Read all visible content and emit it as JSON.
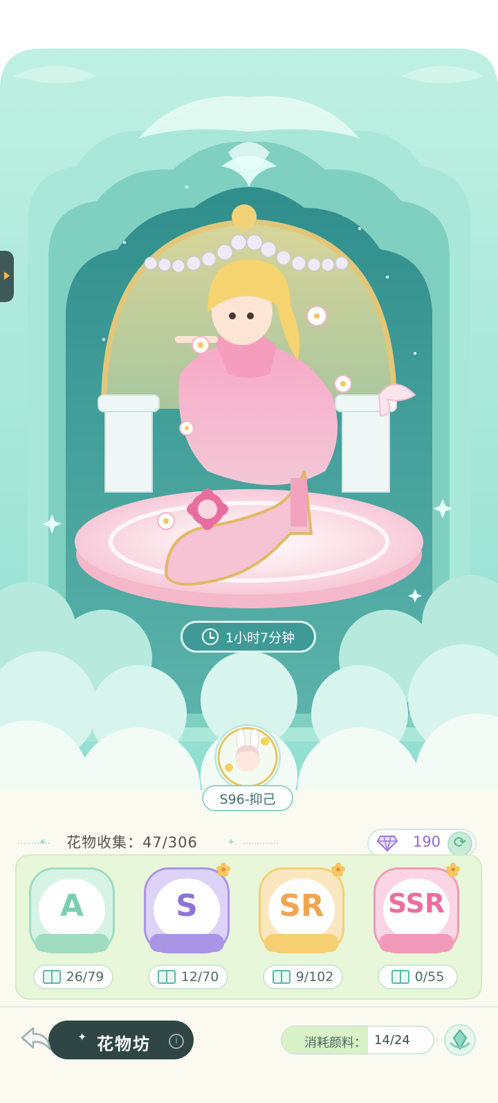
{
  "timer": {
    "text": "1小时7分钟"
  },
  "season": {
    "label": "S96-抑己"
  },
  "collection": {
    "title": "花物收集：47/306",
    "gems": "190"
  },
  "rarities": [
    {
      "letter": "A",
      "count": "26/79",
      "color": "#7ccfb0",
      "shield": "#d6f3e6",
      "ribbon": "#9fdcc0"
    },
    {
      "letter": "S",
      "count": "12/70",
      "color": "#8d73d9",
      "shield": "#dcd3f6",
      "ribbon": "#a994e6"
    },
    {
      "letter": "SR",
      "count": "9/102",
      "color": "#f0a650",
      "shield": "#fbe7bf",
      "ribbon": "#f5cf72"
    },
    {
      "letter": "SSR",
      "count": "0/55",
      "color": "#e86f9e",
      "shield": "#fbd5e3",
      "ribbon": "#f19ab9"
    }
  ],
  "bottom": {
    "workshop_label": "花物坊",
    "info_icon": "i",
    "consume_label": "消耗颜料：",
    "consume_value": "14/24"
  },
  "icons": {
    "timer": "clock-icon",
    "gem": "diamond-icon",
    "refresh": "refresh-icon",
    "back": "back-arrow-icon",
    "pigment": "pigment-icon"
  }
}
